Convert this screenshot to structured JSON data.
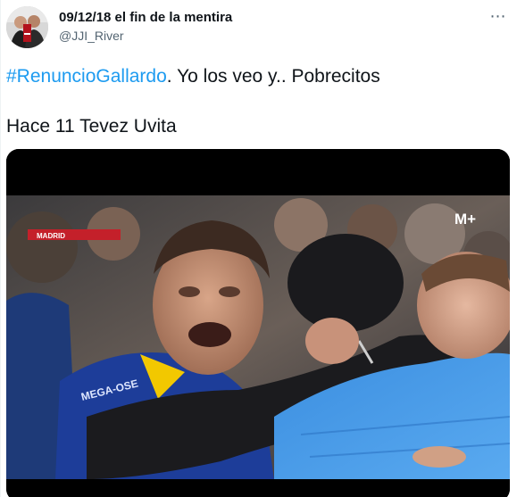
{
  "tweet": {
    "display_name": "09/12/18 el fin de la mentira",
    "handle": "@JJI_River",
    "more_icon": "⋯",
    "hashtag": "#RenuncioGallardo",
    "text_after_hashtag": ". Yo los veo y.. Pobrecitos",
    "line2": "Hace 11 Tevez Uvita",
    "hashtag_color": "#1d9bf0"
  },
  "media": {
    "channel_logo": "M+",
    "banner_text": "MADRID",
    "jersey_text": "MEGA-OSE"
  }
}
